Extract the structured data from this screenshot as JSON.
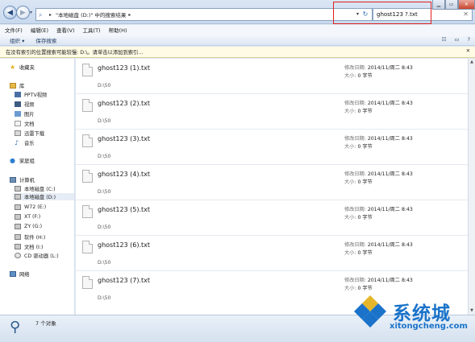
{
  "address_bar": {
    "breadcrumb": "\"本地磁盘 (D:)\" 中的搜索结果",
    "search_query": "ghost123 ?.txt"
  },
  "menu": [
    "文件(F)",
    "编辑(E)",
    "查看(V)",
    "工具(T)",
    "帮助(H)"
  ],
  "toolbar": {
    "organize": "组织 ▾",
    "save_search": "保存搜索"
  },
  "info_bar": {
    "message": "在没有索引的位置搜索可能较慢: D:\\。请单击以添加到索引..."
  },
  "sidebar": {
    "favorites": "收藏夹",
    "library": "库",
    "library_items": [
      "PPTV视频",
      "视频",
      "图片",
      "文档",
      "迅雷下载",
      "音乐"
    ],
    "homegroup": "家庭组",
    "computer": "计算机",
    "drives": [
      "本地磁盘 (C:)",
      "本地磁盘 (D:)",
      "W72 (E:)",
      "XT (F:)",
      "ZY (G:)",
      "软件 (H:)",
      "文档 (I:)",
      "CD 驱动器 (L:)"
    ],
    "network": "网络"
  },
  "files": [
    {
      "name": "ghost123 (1).txt",
      "path": "D:\\50",
      "modified": "2014/11/周二 8:43",
      "size": "0 字节"
    },
    {
      "name": "ghost123 (2).txt",
      "path": "D:\\50",
      "modified": "2014/11/周二 8:43",
      "size": "0 字节"
    },
    {
      "name": "ghost123 (3).txt",
      "path": "D:\\50",
      "modified": "2014/11/周二 8:43",
      "size": "0 字节"
    },
    {
      "name": "ghost123 (4).txt",
      "path": "D:\\50",
      "modified": "2014/11/周二 8:43",
      "size": "0 字节"
    },
    {
      "name": "ghost123 (5).txt",
      "path": "D:\\50",
      "modified": "2014/11/周二 8:43",
      "size": "0 字节"
    },
    {
      "name": "ghost123 (6).txt",
      "path": "D:\\50",
      "modified": "2014/11/周二 8:43",
      "size": "0 字节"
    },
    {
      "name": "ghost123 (7).txt",
      "path": "D:\\50",
      "modified": "2014/11/周二 8:43",
      "size": "0 字节"
    }
  ],
  "labels": {
    "modified": "修改日期:",
    "size": "大小:"
  },
  "status": {
    "count": "7 个对象"
  },
  "watermark": {
    "title": "系统城",
    "url": "xitongcheng.com"
  },
  "colors": {
    "highlight": "#e0201c",
    "brand": "#1a73c9"
  }
}
